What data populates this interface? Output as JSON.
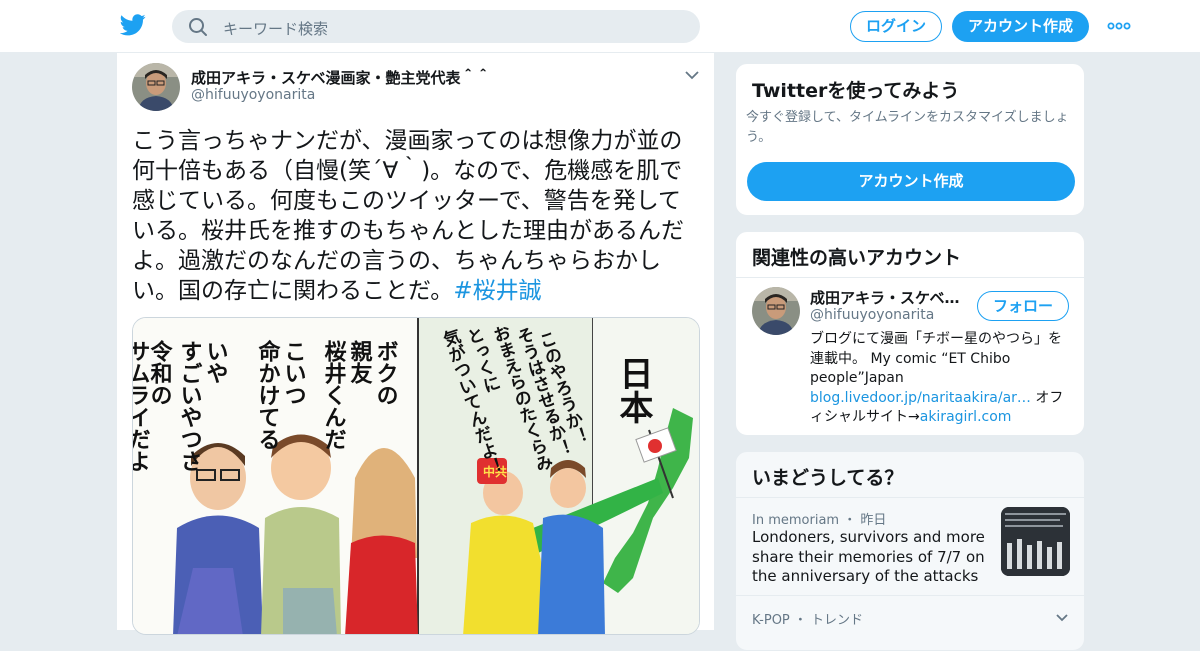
{
  "header": {
    "logo_icon": "twitter-bird-icon",
    "search_placeholder": "キーワード検索",
    "login_label": "ログイン",
    "signup_label": "アカウント作成",
    "more_icon": "more-dots-icon",
    "brand_color": "#1da1f2"
  },
  "tweet": {
    "display_name": "成田アキラ・スケベ漫画家・艶主党代表＾＾",
    "handle": "@hifuuyoyonarita",
    "text": "こう言っちゃナンだが、漫画家ってのは想像力が並の何十倍もある（自慢(笑´∀｀)。なので、危機感を肌で感じている。何度もこのツイッターで、警告を発している。桜井氏を推すのもちゃんとした理由があるんだよ。過激だのなんだの言うの、ちゃんちゃらおかしい。国の存亡に関わることだ。",
    "hashtag": "#桜井誠",
    "comic": {
      "panel_left_lines": [
        "ボクの",
        "親友",
        "桜井くんだ",
        "こいつ",
        "命かけてる",
        "いや",
        "すごいやつさ",
        "令和の",
        "サムライだよ"
      ],
      "panel_right_lines": [
        "このやろうか！",
        "そうはさせるか！",
        "おまえらのたくらみ",
        "とっくに",
        "気がついてんだよ！"
      ],
      "japan_label": "日本",
      "badge_label": "中共"
    }
  },
  "sidebar": {
    "try_card": {
      "title": "Twitterを使ってみよう",
      "subtitle": "今すぐ登録して、タイムラインをカスタマイズしましょう。",
      "button_label": "アカウント作成"
    },
    "related_card": {
      "title": "関連性の高いアカウント",
      "account": {
        "name": "成田アキラ・スケベ…",
        "handle": "@hifuuyoyonarita",
        "follow_label": "フォロー",
        "bio_1": "ブログにて漫画「チボー星のやつら」を連載中。 My comic “ET Chibo people”Japan ",
        "bio_link_1": "blog.livedoor.jp/naritaakira/ar…",
        "bio_2": " オフィシャルサイト→",
        "bio_link_2": "akiragirl.com"
      }
    },
    "trends_card": {
      "title": "いまどうしてる？",
      "item_context": "In memoriam ・ 昨日",
      "item_headline": "Londoners, survivors and more share their memories of 7/7 on the anniversary of the attacks",
      "next_context": "K-POP ・ トレンド"
    }
  }
}
